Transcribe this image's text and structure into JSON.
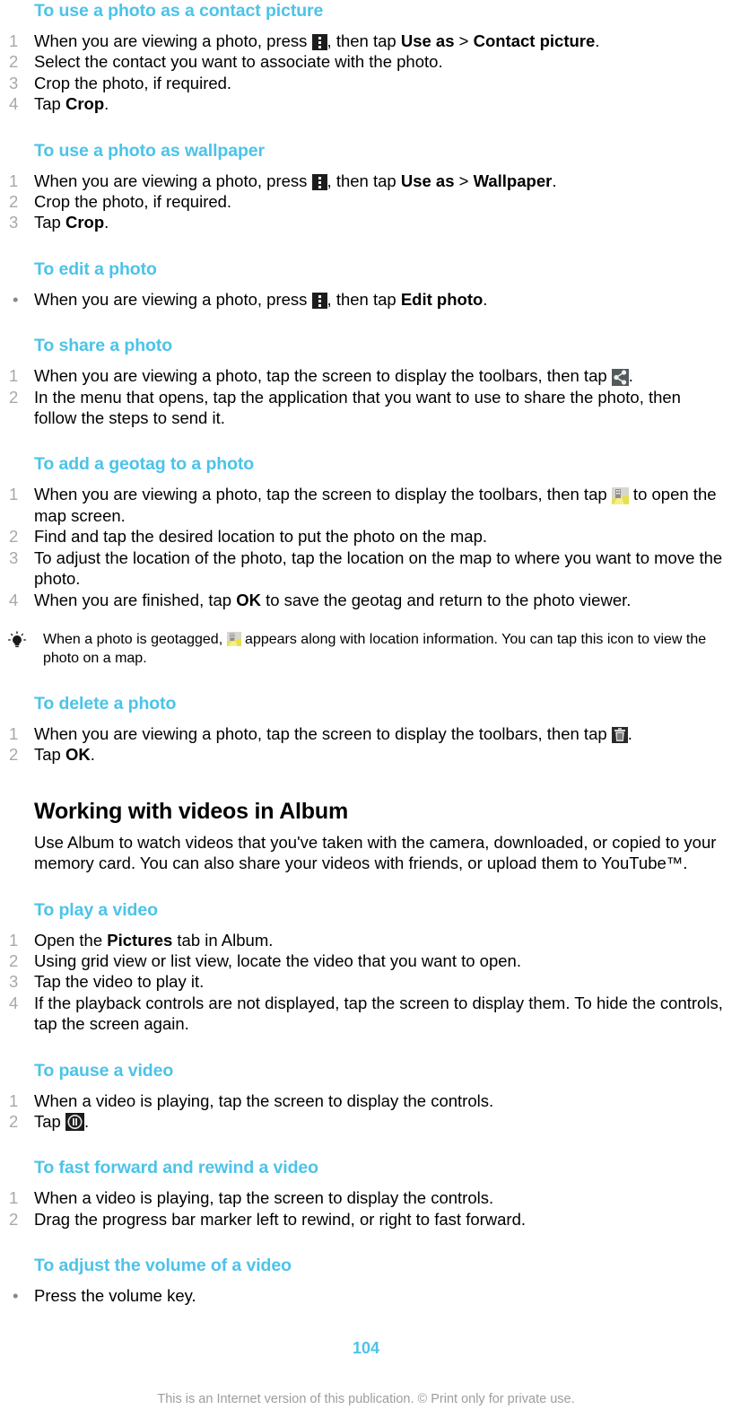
{
  "document": {
    "page_number": "104",
    "footer_text": "This is an Internet version of this publication. © Print only for private use.",
    "accent_color": "#4cc3e9",
    "number_color": "#a8a8a8"
  },
  "sections": {
    "contact_picture": {
      "heading": "To use a photo as a contact picture",
      "steps": [
        {
          "num": "1",
          "pre": "When you are viewing a photo, press ",
          "icon": "overflow-menu-icon",
          "mid": ", then tap ",
          "bold1": "Use as",
          "sep": " > ",
          "bold2": "Contact picture",
          "post": "."
        },
        {
          "num": "2",
          "text": "Select the contact you want to associate with the photo."
        },
        {
          "num": "3",
          "text": "Crop the photo, if required."
        },
        {
          "num": "4",
          "pre": "Tap ",
          "bold1": "Crop",
          "post": "."
        }
      ]
    },
    "wallpaper": {
      "heading": "To use a photo as wallpaper",
      "steps": [
        {
          "num": "1",
          "pre": "When you are viewing a photo, press ",
          "icon": "overflow-menu-icon",
          "mid": ", then tap ",
          "bold1": "Use as",
          "sep": " > ",
          "bold2": "Wallpaper",
          "post": "."
        },
        {
          "num": "2",
          "text": "Crop the photo, if required."
        },
        {
          "num": "3",
          "pre": "Tap ",
          "bold1": "Crop",
          "post": "."
        }
      ]
    },
    "edit_photo": {
      "heading": "To edit a photo",
      "bullet": {
        "pre": "When you are viewing a photo, press ",
        "icon": "overflow-menu-icon",
        "mid": ", then tap ",
        "bold1": "Edit photo",
        "post": "."
      }
    },
    "share_photo": {
      "heading": "To share a photo",
      "steps": [
        {
          "num": "1",
          "pre": "When you are viewing a photo, tap the screen to display the toolbars, then tap ",
          "icon": "share-icon",
          "post": "."
        },
        {
          "num": "2",
          "text": "In the menu that opens, tap the application that you want to use to share the photo, then follow the steps to send it."
        }
      ]
    },
    "geotag": {
      "heading": "To add a geotag to a photo",
      "steps": [
        {
          "num": "1",
          "pre": "When you are viewing a photo, tap the screen to display the toolbars, then tap ",
          "icon": "geotag-map-icon",
          "post": " to open the map screen."
        },
        {
          "num": "2",
          "text": "Find and tap the desired location to put the photo on the map."
        },
        {
          "num": "3",
          "text": "To adjust the location of the photo, tap the location on the map to where you want to move the photo."
        },
        {
          "num": "4",
          "pre": "When you are finished, tap ",
          "bold1": "OK",
          "post": " to save the geotag and return to the photo viewer."
        }
      ],
      "tip": {
        "pre": "When a photo is geotagged, ",
        "icon": "geotag-map-icon",
        "post": " appears along with location information. You can tap this icon to view the photo on a map."
      }
    },
    "delete_photo": {
      "heading": "To delete a photo",
      "steps": [
        {
          "num": "1",
          "pre": "When you are viewing a photo, tap the screen to display the toolbars, then tap ",
          "icon": "trash-icon",
          "post": "."
        },
        {
          "num": "2",
          "pre": "Tap ",
          "bold1": "OK",
          "post": "."
        }
      ]
    },
    "videos": {
      "heading": "Working with videos in Album",
      "intro": "Use Album to watch videos that you've taken with the camera, downloaded, or copied to your memory card. You can also share your videos with friends, or upload them to YouTube™."
    },
    "play_video": {
      "heading": "To play a video",
      "steps": [
        {
          "num": "1",
          "pre": "Open the ",
          "bold1": "Pictures",
          "post": " tab in Album."
        },
        {
          "num": "2",
          "text": "Using grid view or list view, locate the video that you want to open."
        },
        {
          "num": "3",
          "text": "Tap the video to play it."
        },
        {
          "num": "4",
          "text": "If the playback controls are not displayed, tap the screen to display them. To hide the controls, tap the screen again."
        }
      ]
    },
    "pause_video": {
      "heading": "To pause a video",
      "steps": [
        {
          "num": "1",
          "text": "When a video is playing, tap the screen to display the controls."
        },
        {
          "num": "2",
          "pre": "Tap ",
          "icon": "pause-icon",
          "post": "."
        }
      ]
    },
    "fast_forward": {
      "heading": "To fast forward and rewind a video",
      "steps": [
        {
          "num": "1",
          "text": "When a video is playing, tap the screen to display the controls."
        },
        {
          "num": "2",
          "text": "Drag the progress bar marker left to rewind, or right to fast forward."
        }
      ]
    },
    "volume": {
      "heading": "To adjust the volume of a video",
      "bullet": {
        "text": "Press the volume key."
      }
    }
  }
}
